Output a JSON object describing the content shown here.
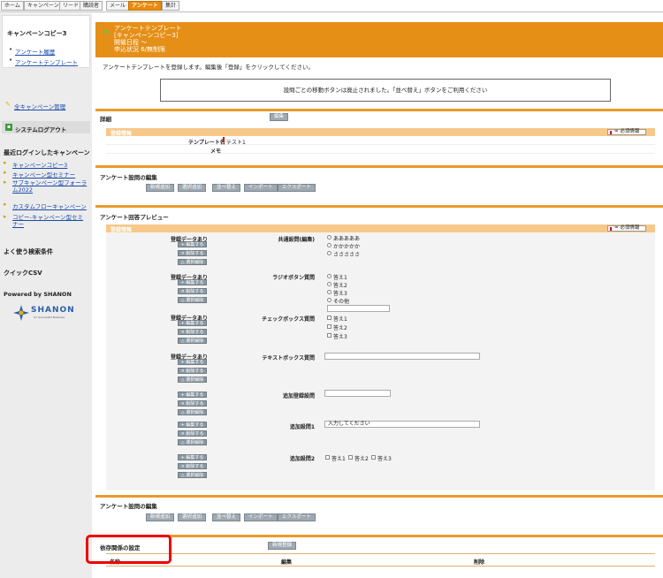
{
  "topnav": {
    "tabs": [
      "ホーム",
      "キャンペーン",
      "リード",
      "購読者",
      "メール",
      "アンケート",
      "集計"
    ],
    "active_index": 5
  },
  "sidebar": {
    "title": "キャンペーンコピー3",
    "links": [
      "アンケート履歴",
      "アンケートテンプレート"
    ],
    "all_campaign": "全キャンペーン管理",
    "logout": "システムログアウト",
    "recent_title": "最近ログインしたキャンペーン",
    "recent": [
      "キャンペーンコピー3",
      "キャンペーン型セミナー",
      "サブキャンペーン型フォーラム2022",
      "カスタムフローキャンペーン",
      "コピー-キャンペーン型セミナー"
    ],
    "search": "よく使う検索条件",
    "csv": "クイックCSV",
    "powered": "Powered by SHANON",
    "logo_text": "SHANON",
    "logo_sub": "for Successful Business"
  },
  "header": {
    "line1": "アンケートテンプレート",
    "line2": "[キャンペーンコピー3]",
    "line3": "開催日程  〜",
    "line4": "申込状況  6/無制限"
  },
  "intro": "アンケートテンプレートを登録します。編集後「登録」をクリックしてください。",
  "notice": "設問ごとの移動ボタンは廃止されました。「並べ替え」ボタンをご利用ください",
  "detail": {
    "title": "詳細",
    "edit": "編集",
    "bar": "登録情報",
    "required": "= 必須情報",
    "template_label": "テンプレート名",
    "template_value": "テスト1",
    "memo_label": "メモ"
  },
  "q_edit": {
    "title": "アンケート設問の編集",
    "buttons": [
      "新規追加",
      "選択追加",
      "並べ替え",
      "インポート",
      "エクスポート"
    ]
  },
  "preview": {
    "title": "アンケート回答プレビュー",
    "bar": "登録情報",
    "required": "= 必須情報",
    "data_label": "登録データあり",
    "btn_edit": "+ 編集する",
    "btn_delete": "× 削除する",
    "btn_unselect": "△ 選択解除",
    "q1": {
      "label": "共通設問(編集)",
      "options": [
        "あああああ",
        "かかかかか",
        "さささささ"
      ]
    },
    "q2": {
      "label": "ラジオボタン質問",
      "options": [
        "答え1",
        "答え2",
        "答え3",
        "その他"
      ]
    },
    "q3": {
      "label": "チェックボックス質問",
      "options": [
        "答え1",
        "答え2",
        "答え3"
      ]
    },
    "q4": {
      "label": "テキストボックス質問"
    },
    "q5": {
      "label": "追加登録設問"
    },
    "q6": {
      "label": "追加設問1",
      "value": "入力してください"
    },
    "q7": {
      "label": "追加設問2",
      "options": [
        "答え1",
        "答え2",
        "答え3"
      ]
    }
  },
  "q_edit2": {
    "title": "アンケート設問の編集",
    "buttons": [
      "新規追加",
      "選択追加",
      "並べ替え",
      "インポート",
      "エクスポート"
    ]
  },
  "deps": {
    "title": "依存関係の設定",
    "new": "新規登録",
    "col_name": "名称",
    "col_edit": "編集",
    "col_delete": "削除"
  },
  "colors": {
    "accent": "#e58f17",
    "highlight": "#e00000"
  }
}
